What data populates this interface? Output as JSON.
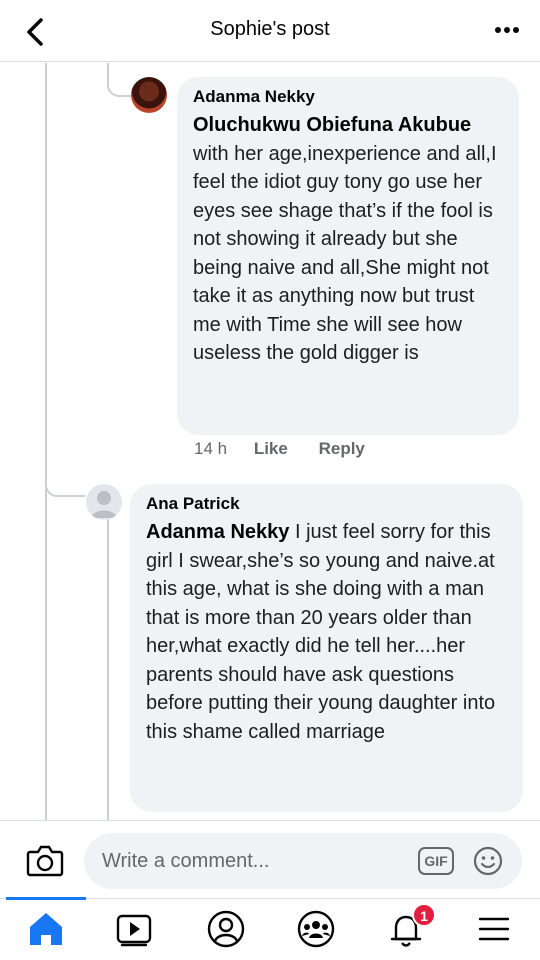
{
  "header": {
    "title": "Sophie's post",
    "back_icon": "chevron-left-icon",
    "more_icon": "more-dots-icon"
  },
  "comments": [
    {
      "author": "Adanma Nekky",
      "mention": "Oluchukwu Obiefuna Akubue",
      "text": " with her age,inexperience and all,I feel the idiot guy tony go use her eyes see shage  that’s if the fool is not showing it already but she being naive and all,She might not take it as anything now but trust me with Time she will see how useless the gold digger is",
      "time": "14 h",
      "like_label": "Like",
      "reply_label": "Reply"
    },
    {
      "author": "Ana Patrick",
      "mention": "Adanma Nekky",
      "text": " I just feel sorry for this girl I swear,she’s so young and naive.at this age, what is she doing with a man that is more than 20 years older than her,what exactly did he tell her....her parents should have ask questions before putting their young daughter into this shame called marriage"
    }
  ],
  "composer": {
    "placeholder": "Write a comment...",
    "gif_label": "GIF"
  },
  "nav": {
    "notifications_badge": "1"
  },
  "colors": {
    "accent": "#1877f2",
    "bubble": "#f0f2f5",
    "badge": "#e41e3f"
  }
}
